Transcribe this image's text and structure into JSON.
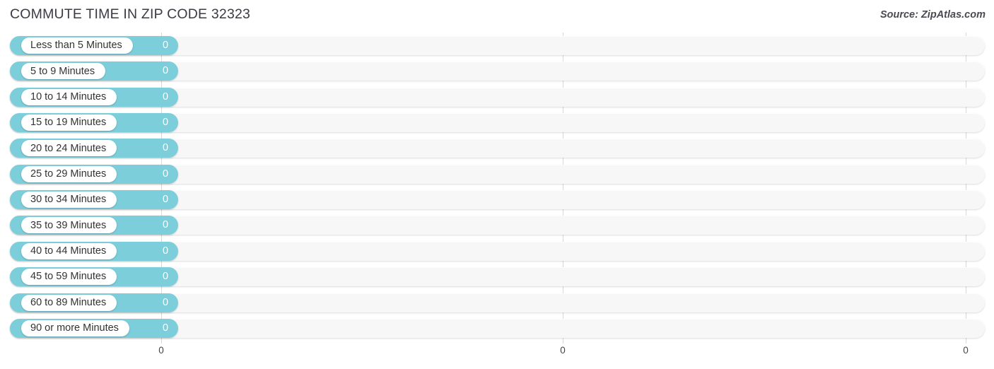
{
  "header": {
    "title": "COMMUTE TIME IN ZIP CODE 32323",
    "source": "Source: ZipAtlas.com"
  },
  "colors": {
    "bar": "#7ccedb",
    "track": "#f7f7f7",
    "gridline": "#d8d8d8",
    "title_text": "#3b3b45",
    "value_text": "#ffffff"
  },
  "chart_data": {
    "type": "bar",
    "orientation": "horizontal",
    "title": "COMMUTE TIME IN ZIP CODE 32323",
    "xlabel": "",
    "ylabel": "",
    "grid": true,
    "legend": false,
    "xlim": [
      0,
      0
    ],
    "xticks": [
      "0",
      "0",
      "0"
    ],
    "categories": [
      "Less than 5 Minutes",
      "5 to 9 Minutes",
      "10 to 14 Minutes",
      "15 to 19 Minutes",
      "20 to 24 Minutes",
      "25 to 29 Minutes",
      "30 to 34 Minutes",
      "35 to 39 Minutes",
      "40 to 44 Minutes",
      "45 to 59 Minutes",
      "60 to 89 Minutes",
      "90 or more Minutes"
    ],
    "values": [
      0,
      0,
      0,
      0,
      0,
      0,
      0,
      0,
      0,
      0,
      0,
      0
    ],
    "value_labels": [
      "0",
      "0",
      "0",
      "0",
      "0",
      "0",
      "0",
      "0",
      "0",
      "0",
      "0",
      "0"
    ]
  }
}
